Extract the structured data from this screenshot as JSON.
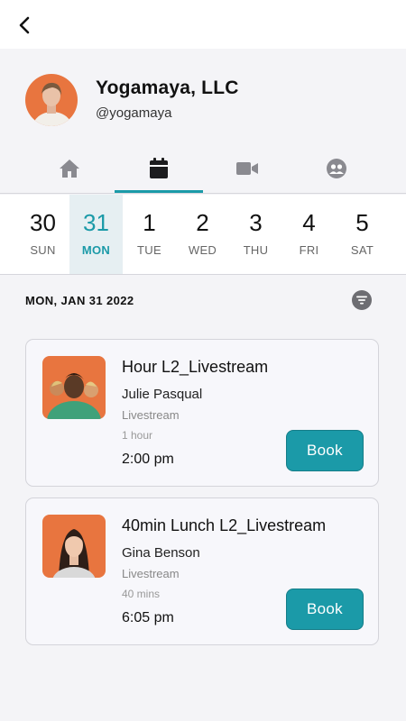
{
  "nav": {
    "back_icon": "chevron-left-icon"
  },
  "studio": {
    "name": "Yogamaya, LLC",
    "handle": "@yogamaya"
  },
  "tabs": [
    {
      "icon": "home-icon",
      "active": false
    },
    {
      "icon": "calendar-icon",
      "active": true
    },
    {
      "icon": "video-camera-icon",
      "active": false
    },
    {
      "icon": "community-icon",
      "active": false
    }
  ],
  "days": [
    {
      "num": "30",
      "name": "SUN",
      "selected": false
    },
    {
      "num": "31",
      "name": "MON",
      "selected": true
    },
    {
      "num": "1",
      "name": "TUE",
      "selected": false
    },
    {
      "num": "2",
      "name": "WED",
      "selected": false
    },
    {
      "num": "3",
      "name": "THU",
      "selected": false
    },
    {
      "num": "4",
      "name": "FRI",
      "selected": false
    },
    {
      "num": "5",
      "name": "SAT",
      "selected": false
    }
  ],
  "schedule": {
    "date_label": "MON, JAN 31 2022",
    "filter_icon": "filter-icon"
  },
  "classes": [
    {
      "title": "Hour L2_Livestream",
      "teacher": "Julie Pasqual",
      "type": "Livestream",
      "duration": "1 hour",
      "time": "2:00 pm",
      "book_label": "Book"
    },
    {
      "title": "40min Lunch L2_Livestream",
      "teacher": "Gina Benson",
      "type": "Livestream",
      "duration": "40 mins",
      "time": "6:05 pm",
      "book_label": "Book"
    }
  ],
  "colors": {
    "accent": "#1b9aa8",
    "selected_day_bg": "#e6eff2",
    "thumb_bg": "#e8753f"
  }
}
